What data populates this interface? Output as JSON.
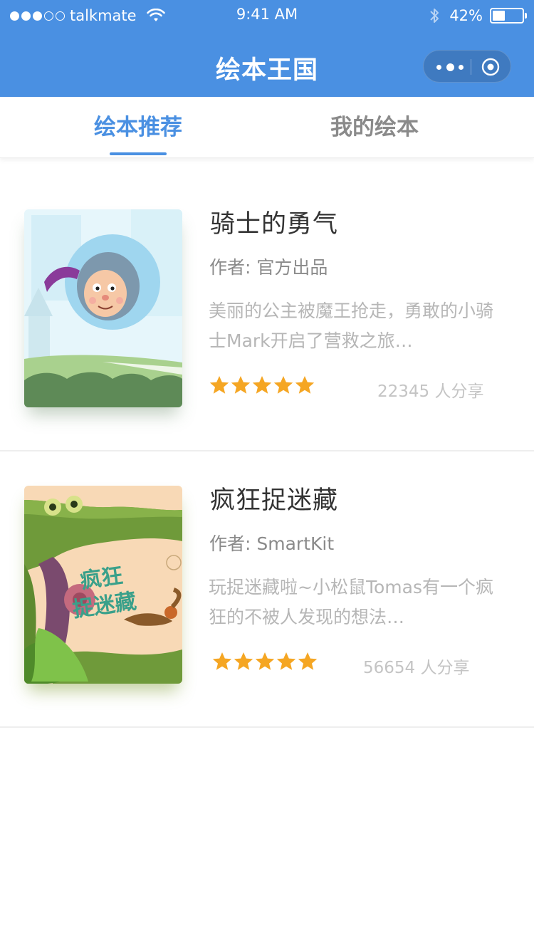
{
  "status_bar": {
    "carrier": "talkmate",
    "time": "9:41 AM",
    "battery_percent": "42%",
    "battery_level": 0.42,
    "signal_bars_filled": 3,
    "signal_bars_total": 5
  },
  "nav": {
    "title": "绘本王国",
    "more_icon": "more-dots-icon",
    "close_icon": "target-circle-icon"
  },
  "tabs": [
    {
      "label": "绘本推荐",
      "active": true
    },
    {
      "label": "我的绘本",
      "active": false
    }
  ],
  "books": [
    {
      "title": "骑士的勇气",
      "author": "作者: 官方出品",
      "description": "美丽的公主被魔王抢走，勇敢的小骑士Mark开启了营救之旅…",
      "rating": 5,
      "shares": "22345 人分享"
    },
    {
      "title": "疯狂捉迷藏",
      "author": "作者: SmartKit",
      "description": "玩捉迷藏啦~小松鼠Tomas有一个疯狂的不被人发现的想法…",
      "rating": 5,
      "shares": "56654 人分享",
      "cover_text": "疯狂捉迷藏"
    }
  ],
  "colors": {
    "primary": "#4a90e2",
    "star": "#f5a623",
    "title_text": "#333333",
    "muted_text": "#8a8a8a",
    "light_text": "#b6b6b6"
  }
}
